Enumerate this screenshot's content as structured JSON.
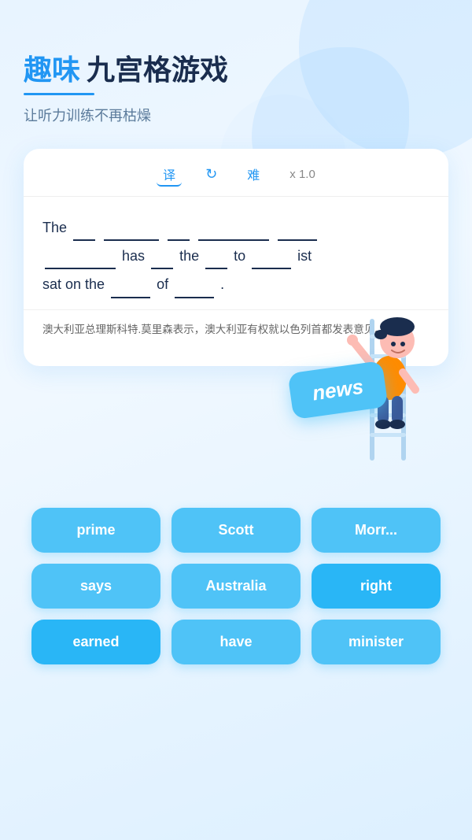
{
  "page": {
    "background_color": "#e8f4ff"
  },
  "header": {
    "title_highlight": "趣味",
    "title_main": "九宫格游戏",
    "subtitle": "让听力训练不再枯燥"
  },
  "toolbar": {
    "translate_label": "译",
    "refresh_icon": "↻",
    "difficulty_label": "难",
    "speed_label": "x 1.0"
  },
  "card": {
    "text_line1": "The",
    "blanks": [
      "",
      "",
      "",
      "",
      "",
      "",
      ""
    ],
    "has_text": "has",
    "the_text": "the",
    "to_text": "to",
    "ist_text": "ist",
    "sat_text": "sat on the",
    "of_text": "of",
    "translation": "澳大利亚总理斯科特.莫里森表示，澳大利亚有权就以色列首都发表意见。"
  },
  "news_tag": {
    "label": "news"
  },
  "word_grid": {
    "items": [
      {
        "id": "word-prime",
        "label": "prime"
      },
      {
        "id": "word-scott",
        "label": "Scott"
      },
      {
        "id": "word-morr",
        "label": "Morr..."
      },
      {
        "id": "word-says",
        "label": "says"
      },
      {
        "id": "word-australia",
        "label": "Australia"
      },
      {
        "id": "word-right",
        "label": "right"
      },
      {
        "id": "word-earned",
        "label": "earned"
      },
      {
        "id": "word-have",
        "label": "have"
      },
      {
        "id": "word-minister",
        "label": "minister"
      }
    ]
  }
}
